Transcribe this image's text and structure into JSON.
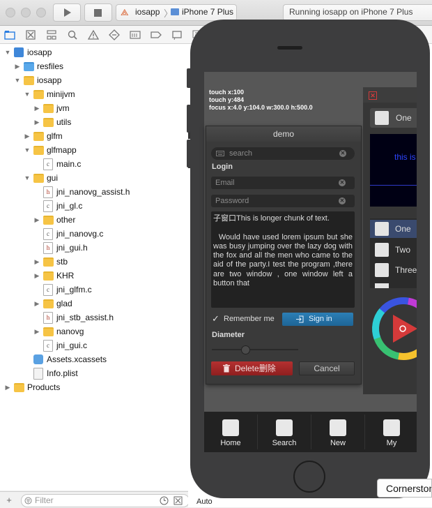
{
  "toolbar": {
    "scheme_name": "iosapp",
    "device_name": "iPhone 7 Plus",
    "status_text": "Running iosapp on iPhone 7 Plus"
  },
  "navigator": {
    "tree": [
      {
        "label": "iosapp",
        "icon": "project-icon",
        "expanded": true
      },
      {
        "label": "resfiles",
        "icon": "folder-blue-icon",
        "expanded": false
      },
      {
        "label": "iosapp",
        "icon": "folder-icon",
        "expanded": true
      },
      {
        "label": "minijvm",
        "icon": "folder-icon",
        "expanded": true
      },
      {
        "label": "jvm",
        "icon": "folder-icon",
        "expanded": false
      },
      {
        "label": "utils",
        "icon": "folder-icon",
        "expanded": false
      },
      {
        "label": "glfm",
        "icon": "folder-icon",
        "expanded": false
      },
      {
        "label": "glfmapp",
        "icon": "folder-icon",
        "expanded": true
      },
      {
        "label": "main.c",
        "icon": "c-file-icon"
      },
      {
        "label": "gui",
        "icon": "folder-icon",
        "expanded": true
      },
      {
        "label": "jni_nanovg_assist.h",
        "icon": "h-file-icon"
      },
      {
        "label": "jni_gl.c",
        "icon": "c-file-icon"
      },
      {
        "label": "other",
        "icon": "folder-icon",
        "expanded": false
      },
      {
        "label": "jni_nanovg.c",
        "icon": "c-file-icon"
      },
      {
        "label": "jni_gui.h",
        "icon": "h-file-icon"
      },
      {
        "label": "stb",
        "icon": "folder-icon",
        "expanded": false
      },
      {
        "label": "KHR",
        "icon": "folder-icon",
        "expanded": false
      },
      {
        "label": "jni_glfm.c",
        "icon": "c-file-icon"
      },
      {
        "label": "glad",
        "icon": "folder-icon",
        "expanded": false
      },
      {
        "label": "jni_stb_assist.h",
        "icon": "h-file-icon"
      },
      {
        "label": "nanovg",
        "icon": "folder-icon",
        "expanded": false
      },
      {
        "label": "jni_gui.c",
        "icon": "c-file-icon"
      },
      {
        "label": "Assets.xcassets",
        "icon": "assets-icon"
      },
      {
        "label": "Info.plist",
        "icon": "plist-icon"
      },
      {
        "label": "Products",
        "icon": "folder-icon",
        "expanded": false
      }
    ],
    "filter_placeholder": "Filter"
  },
  "app": {
    "debug": {
      "line1": "touch x:100",
      "line2": "touch y:484",
      "line3": "focus x:4.0 y:104.0 w:300.0 h:500.0"
    },
    "window_title": "demo",
    "search_placeholder": "search",
    "login_label": "Login",
    "email_placeholder": "Email",
    "password_placeholder": "Password",
    "text_content": "子窗口This is longer chunk of text.\n\n  Would have used lorem ipsum but she    was busy jumping over the lazy dog with the fox and all the men who came to the aid of the party.I test the program ,there are two window , one window left a button that",
    "remember_label": "Remember me",
    "signin_label": "Sign in",
    "diameter_label": "Diameter",
    "slider_value_fraction": 0.38,
    "delete_label": "Delete删除",
    "cancel_label": "Cancel",
    "panel2": {
      "option_top": "One",
      "blue_text": "this is",
      "list": [
        "One",
        "Two",
        "Three"
      ]
    },
    "tabs": [
      "Home",
      "Search",
      "New",
      "My"
    ]
  },
  "editor": {
    "bottom_left_text": "Auto",
    "popover_text": "Cornerstone"
  }
}
